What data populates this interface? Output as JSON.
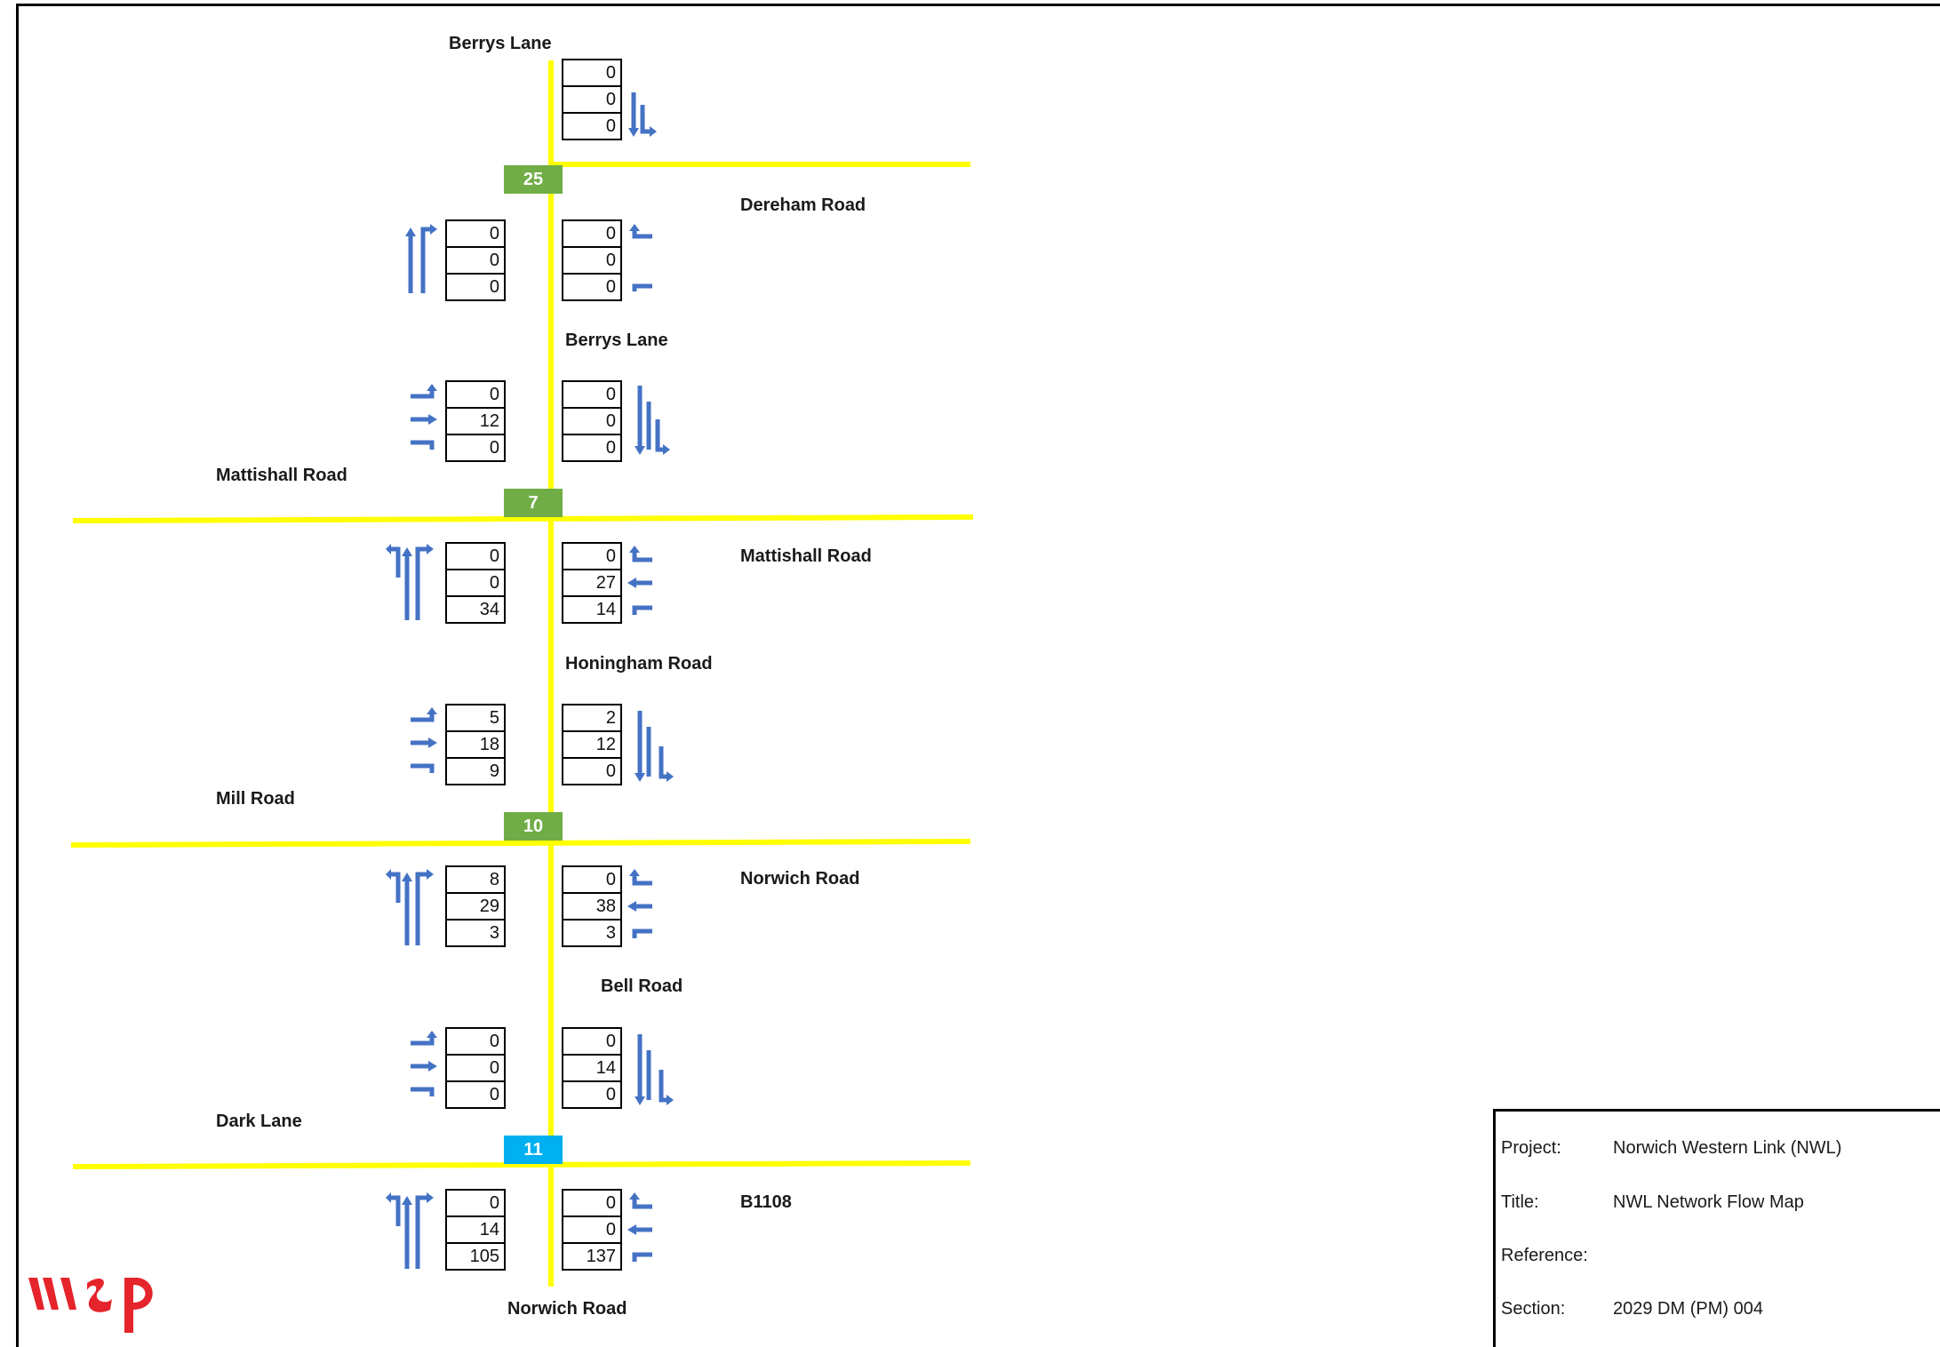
{
  "junctions": [
    {
      "id": "25",
      "color": "#70ad47"
    },
    {
      "id": "7",
      "color": "#70ad47"
    },
    {
      "id": "10",
      "color": "#70ad47"
    },
    {
      "id": "11",
      "color": "#00b0f0"
    }
  ],
  "road_labels": {
    "top": "Berrys Lane",
    "dereham": "Dereham Road",
    "berrys_lower": "Berrys Lane",
    "mattishall_w": "Mattishall Road",
    "mattishall_e": "Mattishall Road",
    "honingham": "Honingham Road",
    "mill": "Mill Road",
    "norwich_e": "Norwich Road",
    "bell": "Bell Road",
    "dark": "Dark Lane",
    "b1108": "B1108",
    "bottom": "Norwich Road"
  },
  "flows": {
    "b1": [
      "0",
      "0",
      "0"
    ],
    "b2": [
      "0",
      "0",
      "0"
    ],
    "b3": [
      "0",
      "0",
      "0"
    ],
    "b4": [
      "0",
      "12",
      "0"
    ],
    "b5": [
      "0",
      "0",
      "0"
    ],
    "b6": [
      "0",
      "0",
      "34"
    ],
    "b7": [
      "0",
      "27",
      "14"
    ],
    "b8": [
      "5",
      "18",
      "9"
    ],
    "b9": [
      "2",
      "12",
      "0"
    ],
    "b10": [
      "8",
      "29",
      "3"
    ],
    "b11": [
      "0",
      "38",
      "3"
    ],
    "b12": [
      "0",
      "0",
      "0"
    ],
    "b13": [
      "0",
      "14",
      "0"
    ],
    "b14": [
      "0",
      "14",
      "105"
    ],
    "b15": [
      "0",
      "0",
      "137"
    ]
  },
  "info": {
    "project_label": "Project:",
    "project_value": "Norwich Western Link (NWL)",
    "title_label": "Title:",
    "title_value": "NWL Network Flow Map",
    "reference_label": "Reference:",
    "reference_value": "",
    "section_label": "Section:",
    "section_value": "2029 DM (PM) 004"
  },
  "logo": {
    "text": "wsp",
    "color": "#e5242b"
  },
  "colors": {
    "road": "#ffff00",
    "arrow": "#4472c4"
  }
}
